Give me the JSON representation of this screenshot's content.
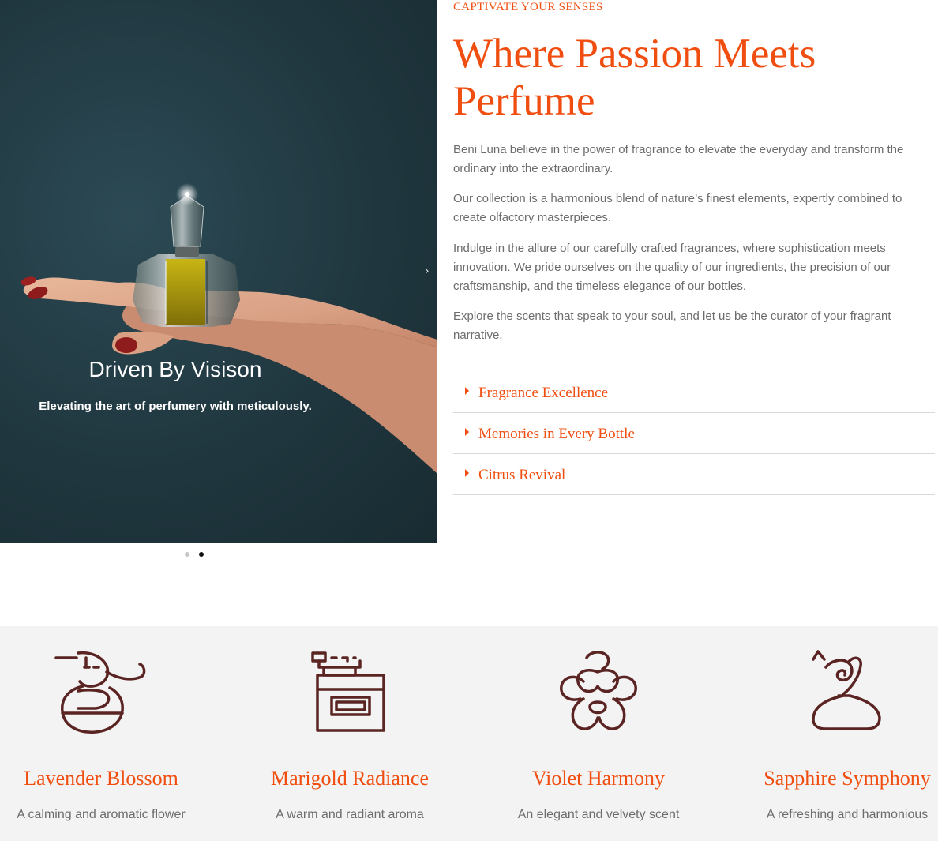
{
  "slider": {
    "title": "Driven By Visison",
    "subtitle": "Elevating the art of perfumery with meticulously.",
    "next_label": "›",
    "active_slide": 2,
    "slide_count": 2
  },
  "intro": {
    "eyebrow": "CAPTIVATE YOUR SENSES",
    "headline": "Where Passion Meets Perfume",
    "paragraphs": [
      "Beni Luna believe in the power of fragrance to elevate the everyday and transform the ordinary into the extraordinary.",
      "Our collection is a harmonious blend of nature’s finest elements, expertly combined to create olfactory masterpieces.",
      "Indulge in the allure of our carefully crafted fragrances, where sophistication meets innovation. We pride ourselves on the quality of our ingredients, the precision of our craftsmanship, and the timeless elegance of our bottles.",
      "Explore the scents that speak to your soul, and let us be the curator of your fragrant narrative."
    ]
  },
  "accordion": [
    {
      "label": "Fragrance Excellence"
    },
    {
      "label": "Memories in Every Bottle"
    },
    {
      "label": "Citrus Revival"
    }
  ],
  "features": [
    {
      "icon": "perfume-sprayer-icon",
      "title": "Lavender Blossom",
      "description": "A calming and aromatic flower"
    },
    {
      "icon": "perfume-bottle-icon",
      "title": "Marigold Radiance",
      "description": "A warm and radiant aroma"
    },
    {
      "icon": "flower-icon",
      "title": "Violet Harmony",
      "description": "An elegant and velvety scent"
    },
    {
      "icon": "scent-drop-icon",
      "title": "Sapphire Symphony",
      "description": "A refreshing and harmonious"
    }
  ],
  "colors": {
    "accent": "#f04e10",
    "icon_stroke": "#5a2423",
    "body_text": "#6c6c6c",
    "band_bg": "#f4f3f3"
  }
}
